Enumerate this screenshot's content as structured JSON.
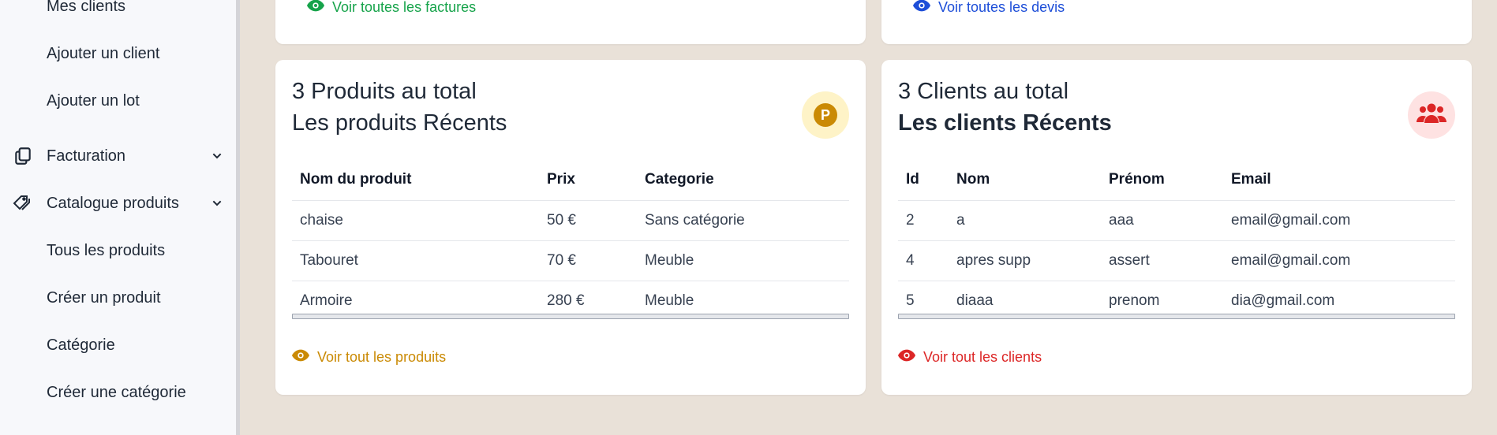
{
  "sidebar": {
    "items": [
      {
        "label": "Mes clients"
      },
      {
        "label": "Ajouter un client"
      },
      {
        "label": "Ajouter un lot"
      },
      {
        "label": "Facturation"
      },
      {
        "label": "Catalogue produits"
      },
      {
        "label": "Tous les produits"
      },
      {
        "label": "Créer un produit"
      },
      {
        "label": "Catégorie"
      },
      {
        "label": "Créer une catégorie"
      }
    ]
  },
  "top_cards": {
    "factures_link": "Voir toutes les factures",
    "devis_link": "Voir toutes les devis"
  },
  "products_card": {
    "count_title": "3 Produits au total",
    "subtitle": "Les produits Récents",
    "badge_letter": "P",
    "columns": [
      "Nom du produit",
      "Prix",
      "Categorie"
    ],
    "rows": [
      [
        "chaise",
        "50 €",
        "Sans catégorie"
      ],
      [
        "Tabouret",
        "70 €",
        "Meuble"
      ],
      [
        "Armoire",
        "280 €",
        "Meuble"
      ]
    ],
    "link": "Voir tout les produits",
    "accent": "#ca8a04"
  },
  "clients_card": {
    "count_title": "3 Clients au total",
    "subtitle": "Les clients Récents",
    "columns": [
      "Id",
      "Nom",
      "Prénom",
      "Email"
    ],
    "rows": [
      [
        "2",
        "a",
        "aaa",
        "email@gmail.com"
      ],
      [
        "4",
        "apres supp",
        "assert",
        "email@gmail.com"
      ],
      [
        "5",
        "diaaa",
        "prenom",
        "dia@gmail.com"
      ]
    ],
    "link": "Voir tout les clients",
    "accent": "#dc2626"
  },
  "colors": {
    "green": "#16a34a",
    "blue": "#1d4ed8",
    "yellow": "#ca8a04",
    "red": "#dc2626"
  }
}
